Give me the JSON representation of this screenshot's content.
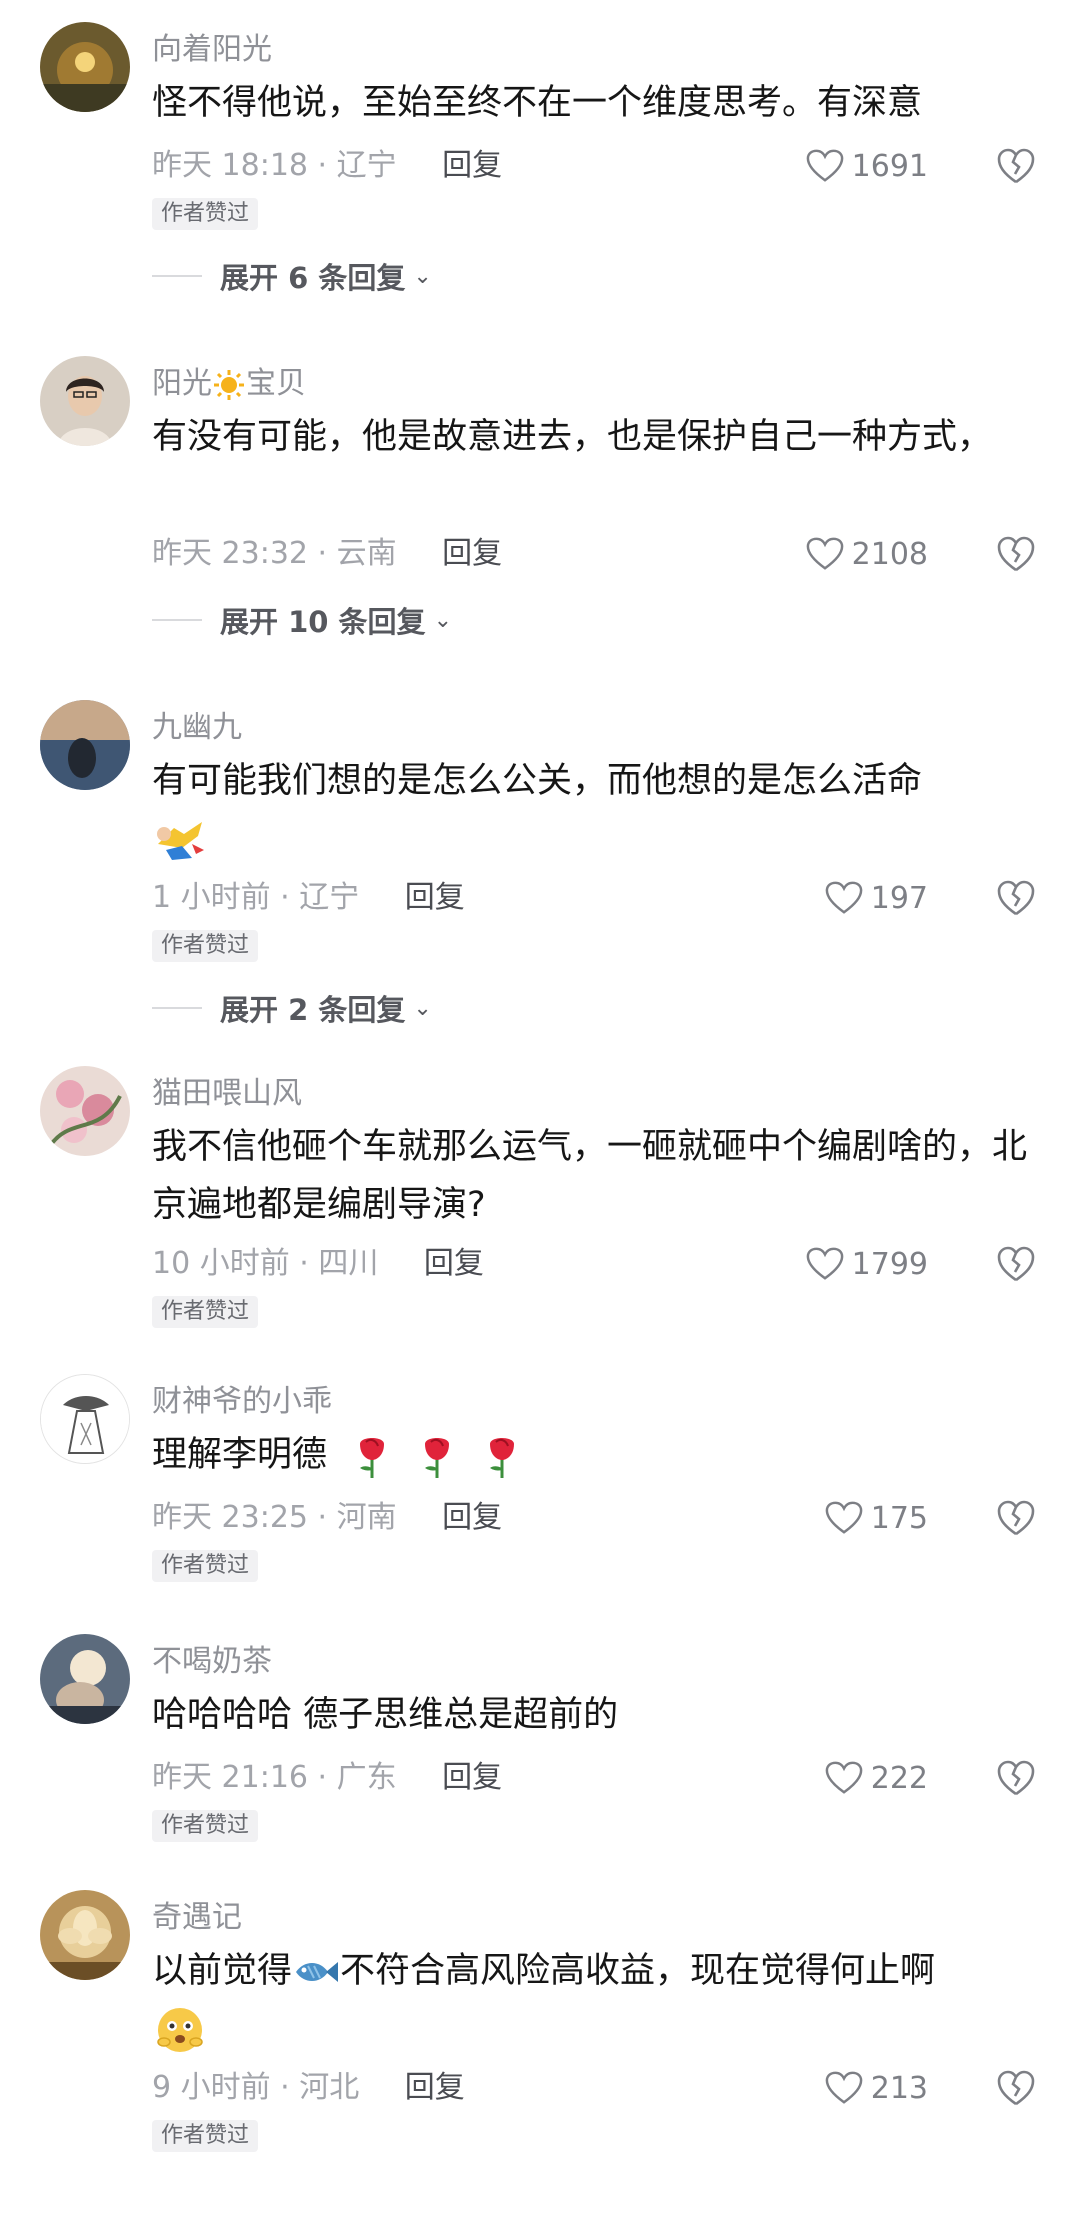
{
  "comments": [
    {
      "username": "向着阳光",
      "text": "怪不得他说，至始至终不在一个维度思考。有深意",
      "time": "昨天 18:18 · 辽宁",
      "reply": "回复",
      "likes": "1691",
      "badge": "作者赞过",
      "expand": "展开 6 条回复",
      "avatar_color": "#8a6b2a"
    },
    {
      "username_a": "阳光",
      "username_b": "宝贝",
      "text": "有没有可能，他是故意进去，也是保护自己一种方式，",
      "time": "昨天 23:32 · 云南",
      "reply": "回复",
      "likes": "2108",
      "expand": "展开 10 条回复",
      "avatar_color": "#b9a48f"
    },
    {
      "username": "九幽九",
      "text": "有可能我们想的是怎么公关，而他想的是怎么活命",
      "time": "1 小时前 · 辽宁",
      "reply": "回复",
      "likes": "197",
      "badge": "作者赞过",
      "expand": "展开 2 条回复",
      "avatar_color": "#4b5f7a"
    },
    {
      "username": "猫田喂山风",
      "text": "我不信他砸个车就那么运气，一砸就砸中个编剧啥的，北京遍地都是编剧导演?",
      "time": "10 小时前 · 四川",
      "reply": "回复",
      "likes": "1799",
      "badge": "作者赞过",
      "avatar_color": "#c99aa6"
    },
    {
      "username": "财神爷的小乖",
      "text": "理解李明德",
      "time": "昨天 23:25 · 河南",
      "reply": "回复",
      "likes": "175",
      "badge": "作者赞过",
      "avatar_color": "#eeeeee"
    },
    {
      "username": "不喝奶茶",
      "text": "哈哈哈哈 德子思维总是超前的",
      "time": "昨天 21:16 · 广东",
      "reply": "回复",
      "likes": "222",
      "badge": "作者赞过",
      "avatar_color": "#6d7a8c"
    },
    {
      "username": "奇遇记",
      "text_a": "以前觉得",
      "text_b": "不符合高风险高收益，现在觉得何止啊",
      "time": "9 小时前 · 河北",
      "reply": "回复",
      "likes": "213",
      "badge": "作者赞过",
      "avatar_color": "#d9b77c"
    }
  ]
}
